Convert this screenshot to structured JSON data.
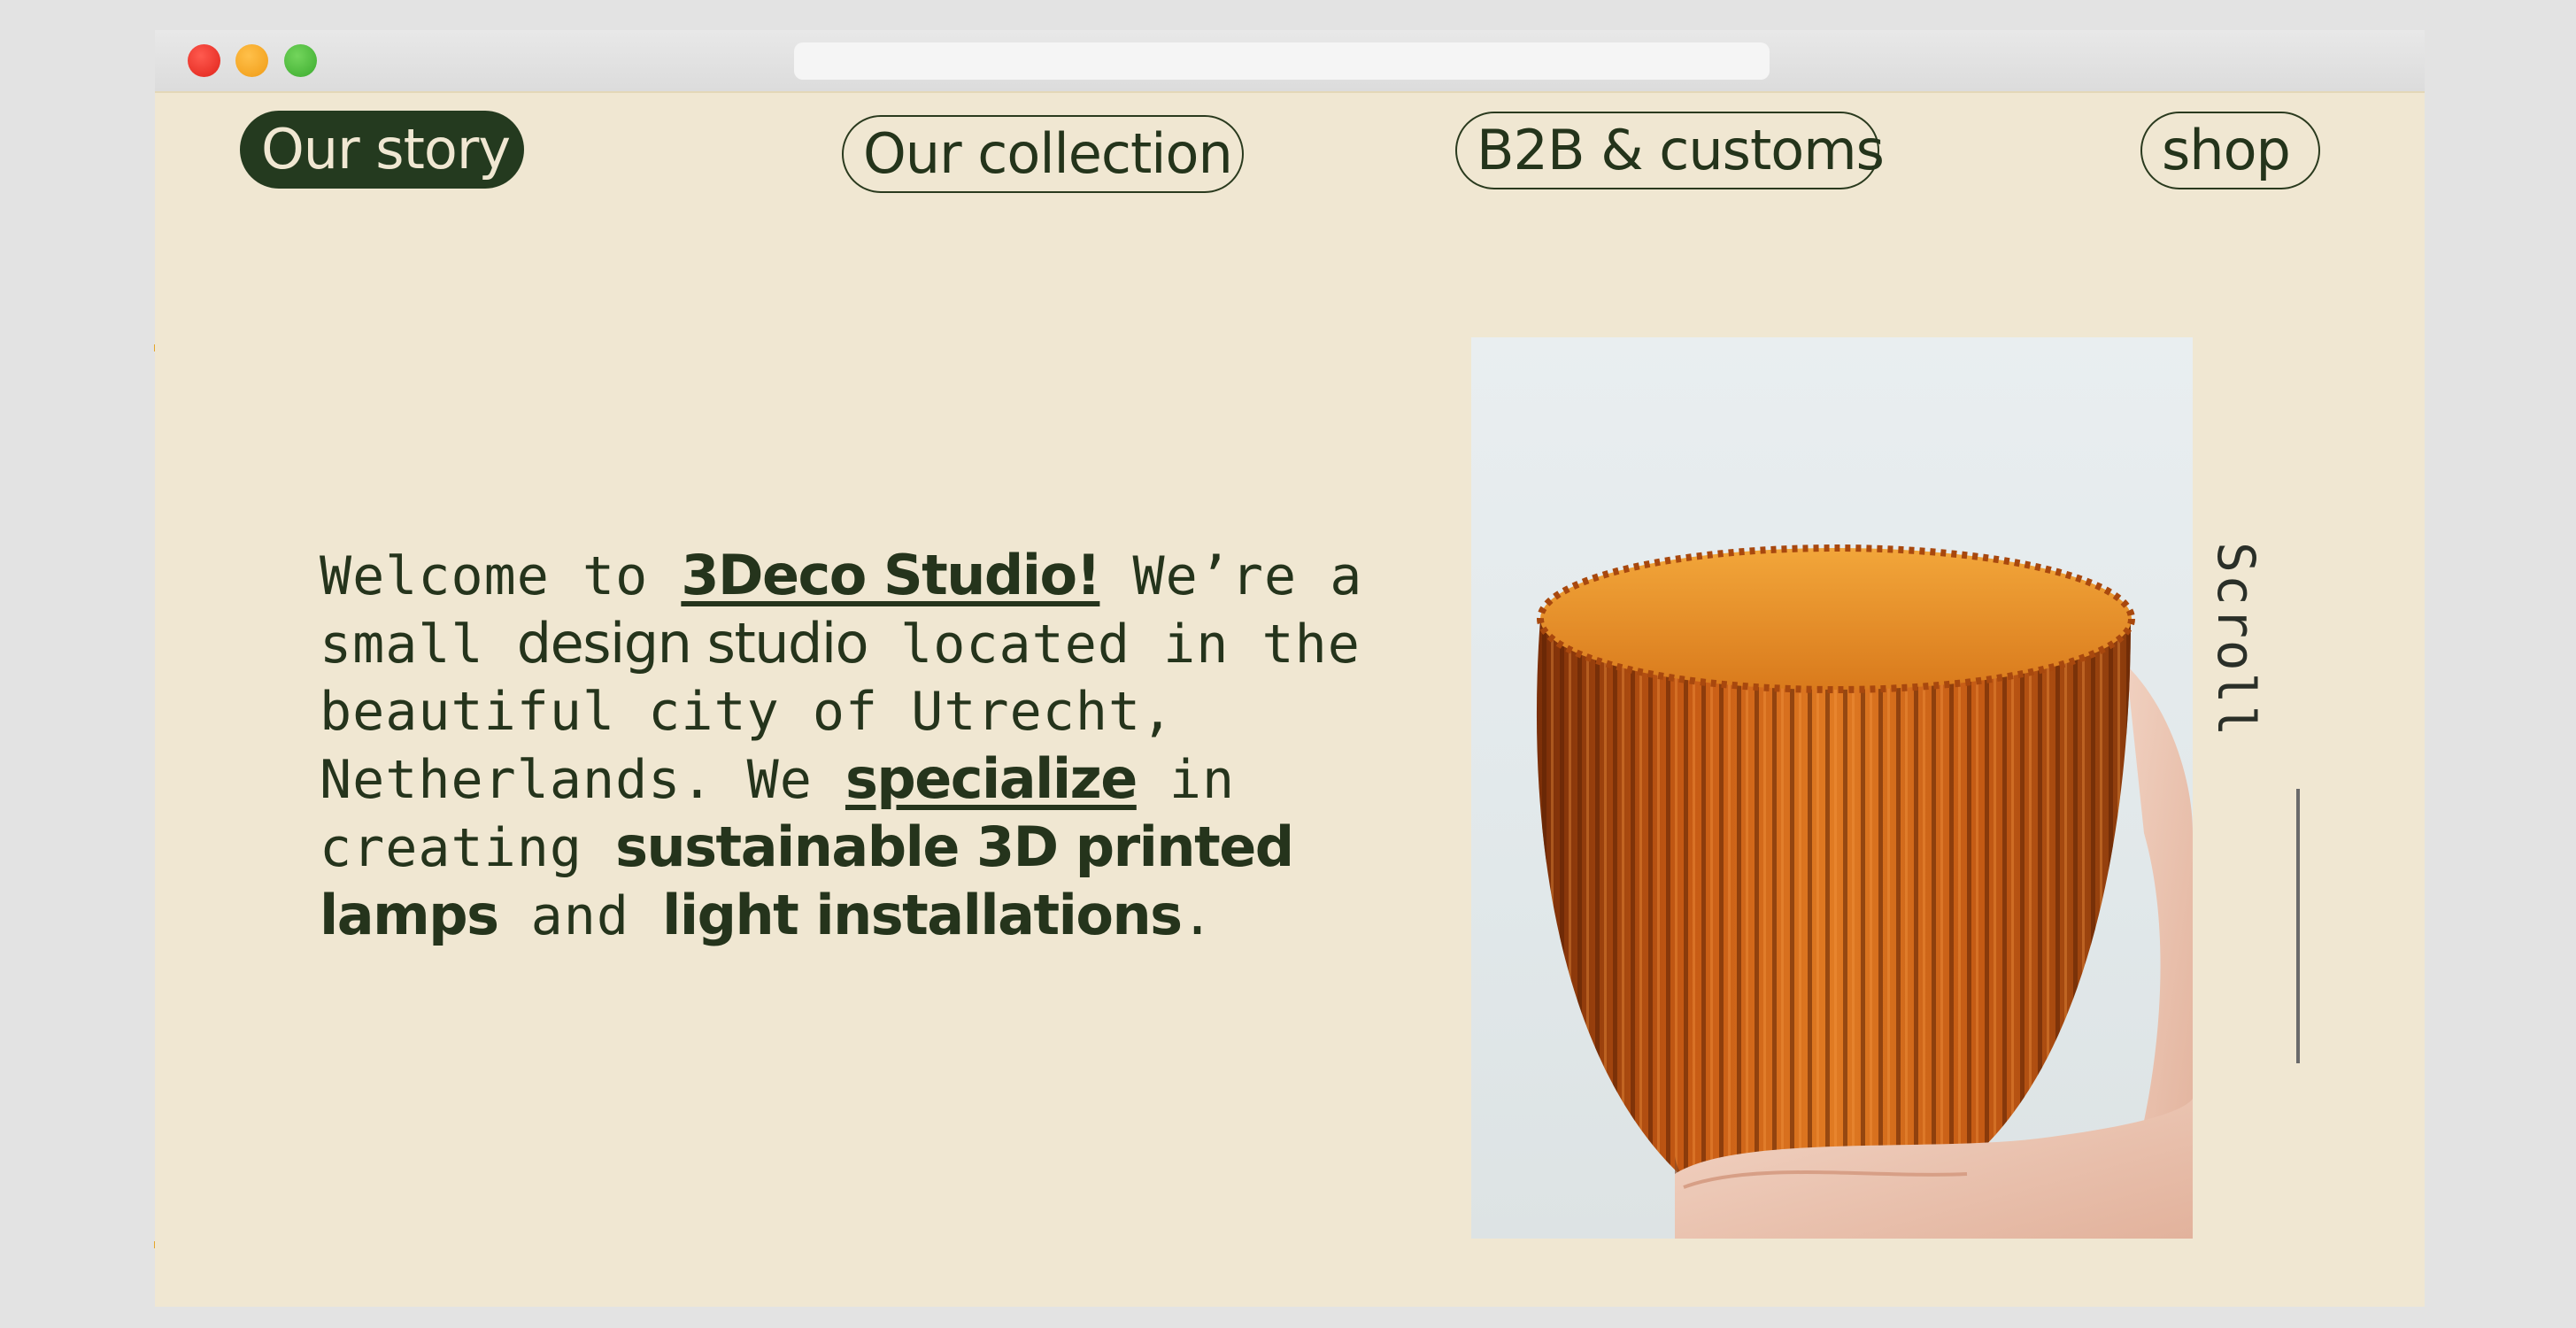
{
  "nav": {
    "our_story": "Our story",
    "our_collection": "Our collection",
    "b2b_customs": "B2B & customs",
    "shop": "shop"
  },
  "intro": {
    "welcome": "Welcome to ",
    "brand": "3Deco Studio!",
    "were_a": " We’re a small ",
    "design_studio": "design studio",
    "located": " located in the beautiful city of Utrecht, Netherlands. We ",
    "specialize": "specialize",
    "in_creating": " in creating ",
    "sustainable": "sustainable 3D printed lamps",
    "and": " and ",
    "light_installations": "light installations",
    "period": "."
  },
  "photo": {
    "icon": "ribbed-orange-lamp-shade-photo"
  },
  "scroll": {
    "label": "Scroll"
  },
  "colors": {
    "background": "#f0e7d2",
    "accent": "#243a1f",
    "lamp_orange": "#c45a14"
  }
}
